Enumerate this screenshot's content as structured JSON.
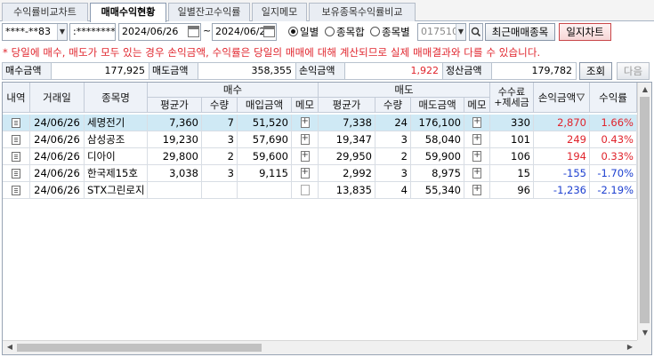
{
  "tabs": [
    {
      "label": "수익률비교차트"
    },
    {
      "label": "매매수익현황"
    },
    {
      "label": "일별잔고수익률"
    },
    {
      "label": "일지메모"
    },
    {
      "label": "보유종목수익률비교"
    }
  ],
  "toolbar": {
    "account": "****-**83",
    "password": ":********",
    "date_from": "2024/06/26",
    "date_sep": "~",
    "date_to": "2024/06/26",
    "radio_daily": "일별",
    "radio_sum": "종목합",
    "radio_by_stock": "종목별",
    "stock_code": "017510",
    "recent_button": "최근매매종목",
    "chart_button": "일지차트"
  },
  "notice": "* 당일에 매수, 매도가 모두 있는 경우 손익금액, 수익률은 당일의 매매에 대해 계산되므로 실제 매매결과와 다를 수 있습니다.",
  "summary": {
    "buy_label": "매수금액",
    "buy_value": "177,925",
    "sell_label": "매도금액",
    "sell_value": "358,355",
    "profit_label": "손익금액",
    "profit_value": "1,922",
    "settle_label": "정산금액",
    "settle_value": "179,782",
    "query_button": "조회",
    "next_button": "다음"
  },
  "grid": {
    "headers": {
      "detail": "내역",
      "date": "거래일",
      "name": "종목명",
      "buy": "매수",
      "sell": "매도",
      "fee": "수수료\n+제세금",
      "profit": "손익금액",
      "rate": "수익률",
      "avg": "평균가",
      "qty": "수량",
      "buy_amount": "매입금액",
      "memo": "메모",
      "sell_amount": "매도금액"
    },
    "rows": [
      {
        "date": "24/06/26",
        "name": "세명전기",
        "buy_avg": "7,360",
        "buy_qty": "7",
        "buy_amt": "51,520",
        "buy_memo": "plus",
        "sell_avg": "7,338",
        "sell_qty": "24",
        "sell_amt": "176,100",
        "fee": "330",
        "profit": "2,870",
        "rate": "1.66%",
        "sign": "pos"
      },
      {
        "date": "24/06/26",
        "name": "삼성공조",
        "buy_avg": "19,230",
        "buy_qty": "3",
        "buy_amt": "57,690",
        "buy_memo": "plus",
        "sell_avg": "19,347",
        "sell_qty": "3",
        "sell_amt": "58,040",
        "fee": "101",
        "profit": "249",
        "rate": "0.43%",
        "sign": "pos"
      },
      {
        "date": "24/06/26",
        "name": "디아이",
        "buy_avg": "29,800",
        "buy_qty": "2",
        "buy_amt": "59,600",
        "buy_memo": "plus",
        "sell_avg": "29,950",
        "sell_qty": "2",
        "sell_amt": "59,900",
        "fee": "106",
        "profit": "194",
        "rate": "0.33%",
        "sign": "pos"
      },
      {
        "date": "24/06/26",
        "name": "한국제15호",
        "buy_avg": "3,038",
        "buy_qty": "3",
        "buy_amt": "9,115",
        "buy_memo": "plus",
        "sell_avg": "2,992",
        "sell_qty": "3",
        "sell_amt": "8,975",
        "fee": "15",
        "profit": "-155",
        "rate": "-1.70%",
        "sign": "neg"
      },
      {
        "date": "24/06/26",
        "name": "STX그린로지",
        "buy_avg": "",
        "buy_qty": "",
        "buy_amt": "",
        "buy_memo": "empty",
        "sell_avg": "13,835",
        "sell_qty": "4",
        "sell_amt": "55,340",
        "fee": "96",
        "profit": "-1,236",
        "rate": "-2.19%",
        "sign": "neg"
      }
    ]
  },
  "colors": {
    "positive": "#e0242c",
    "negative": "#1c3fd0",
    "selected_row": "#cfe9f5",
    "header_bg": "#eef2f8"
  },
  "icons": {
    "detail": "document-icon",
    "memo": "memo-add-icon",
    "calendar": "calendar-icon",
    "search": "search-icon",
    "sort": "sort-icon"
  }
}
